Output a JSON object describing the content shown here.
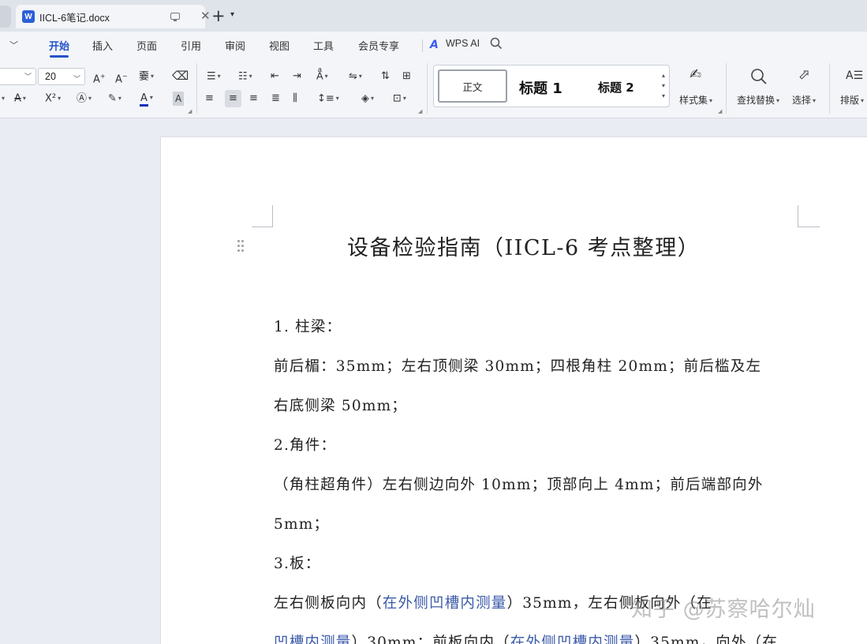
{
  "window": {
    "document_tab_title": "IICL-6笔记.docx",
    "doc_icon_letter": "W"
  },
  "menu": {
    "items": [
      "开始",
      "插入",
      "页面",
      "引用",
      "审阅",
      "视图",
      "工具",
      "会员专享"
    ],
    "active": "开始",
    "wps_ai_label": "WPS AI"
  },
  "toolbar": {
    "font_size": "20",
    "styles": {
      "normal": "正文",
      "heading1": "标题 1",
      "heading2": "标题 2"
    },
    "style_set_label": "样式集",
    "find_replace_label": "查找替换",
    "select_label": "选择",
    "layout_label": "排版"
  },
  "document": {
    "heading": "设备检验指南（IICL-6 考点整理）",
    "paragraphs": [
      {
        "segments": [
          {
            "text": "1. 柱梁：",
            "style": "normal"
          }
        ]
      },
      {
        "segments": [
          {
            "text": "前后楣：35mm；左右顶侧梁 30mm；四根角柱 20mm；前后槛及左",
            "style": "normal"
          }
        ]
      },
      {
        "segments": [
          {
            "text": "右底侧梁 50mm；",
            "style": "normal"
          }
        ]
      },
      {
        "segments": [
          {
            "text": "2.角件：",
            "style": "normal"
          }
        ]
      },
      {
        "segments": [
          {
            "text": "（角柱超角件）左右侧边向外 10mm；顶部向上 4mm；前后端部向外",
            "style": "normal"
          }
        ]
      },
      {
        "segments": [
          {
            "text": "5mm；",
            "style": "normal"
          }
        ]
      },
      {
        "segments": [
          {
            "text": "3.板：",
            "style": "normal"
          }
        ]
      },
      {
        "segments": [
          {
            "text": "左右侧板向内（",
            "style": "normal"
          },
          {
            "text": "在外侧凹槽内测量",
            "style": "blue"
          },
          {
            "text": "）35mm，左右侧板向外（在",
            "style": "normal"
          }
        ]
      },
      {
        "segments": [
          {
            "text": "凹槽内测量",
            "style": "blue"
          },
          {
            "text": "）30mm；前板向内（",
            "style": "normal"
          },
          {
            "text": "在外侧凹槽内测量",
            "style": "blue"
          },
          {
            "text": "）35mm，向外（在",
            "style": "normal"
          }
        ]
      }
    ]
  },
  "watermark": "知乎 @苏察哈尔灿"
}
